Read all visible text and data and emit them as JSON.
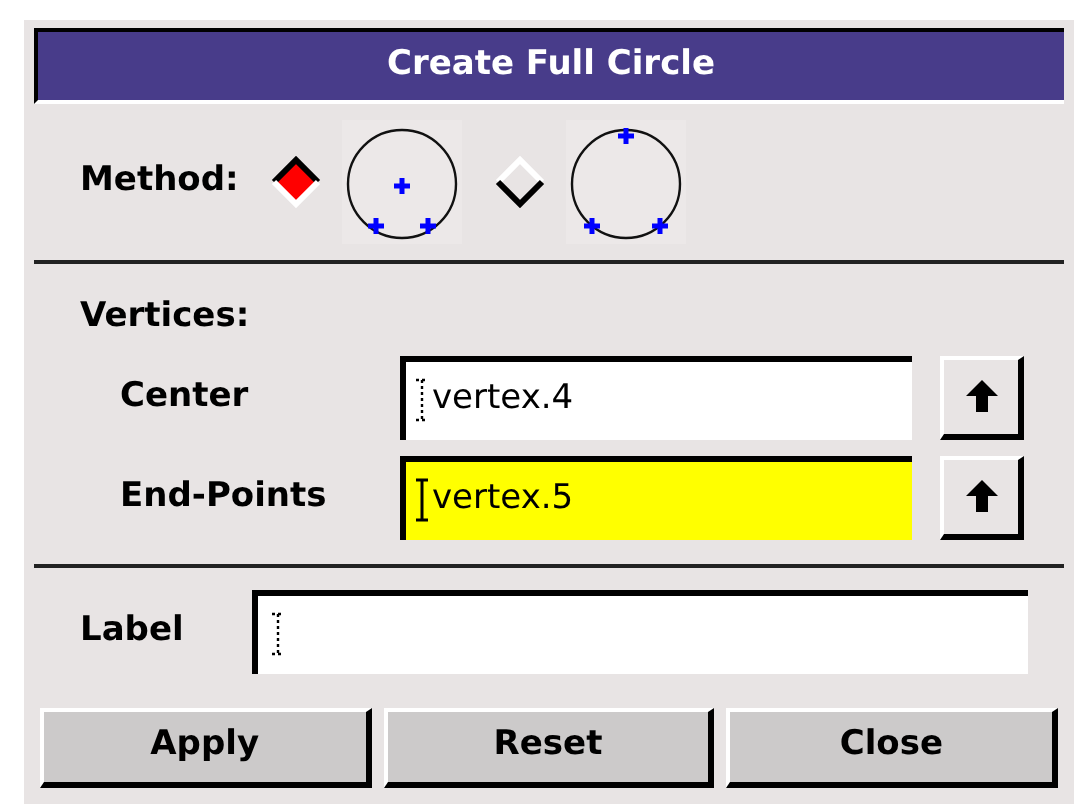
{
  "window": {
    "title": "Create Full Circle"
  },
  "method": {
    "label": "Method:",
    "options": [
      {
        "kind": "center-ends",
        "selected": true
      },
      {
        "kind": "three-points",
        "selected": false
      }
    ]
  },
  "vertices": {
    "label": "Vertices:",
    "fields": [
      {
        "label": "Center",
        "value": "vertex.4",
        "focused": false
      },
      {
        "label": "End-Points",
        "value": "vertex.5",
        "focused": true
      }
    ]
  },
  "label_field": {
    "label": "Label",
    "focused": false
  },
  "buttons": [
    "Apply",
    "Reset",
    "Close"
  ]
}
